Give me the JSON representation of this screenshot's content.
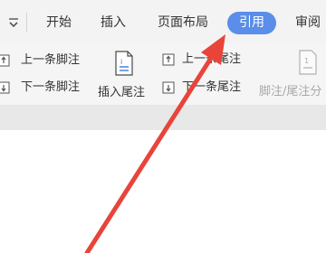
{
  "tabs": [
    {
      "label": "开始",
      "active": false
    },
    {
      "label": "插入",
      "active": false
    },
    {
      "label": "页面布局",
      "active": false
    },
    {
      "label": "引用",
      "active": true
    },
    {
      "label": "审阅",
      "active": false
    }
  ],
  "ribbon": {
    "footnote_prev": "上一条脚注",
    "footnote_next": "下一条脚注",
    "insert_endnote": "插入尾注",
    "endnote_prev": "上一条尾注",
    "endnote_next": "下一条尾注",
    "footnote_endnote_separator": "脚注/尾注分"
  },
  "colors": {
    "active_tab": "#5a8ee8",
    "annotation_arrow": "#e8443a"
  },
  "icons": {
    "quick_access": "chevron-down-icon",
    "prev": "prev-note-icon",
    "next": "next-note-icon",
    "insert_endnote": "insert-endnote-icon",
    "separator": "note-separator-icon",
    "annotation": "red-arrow-annotation"
  }
}
